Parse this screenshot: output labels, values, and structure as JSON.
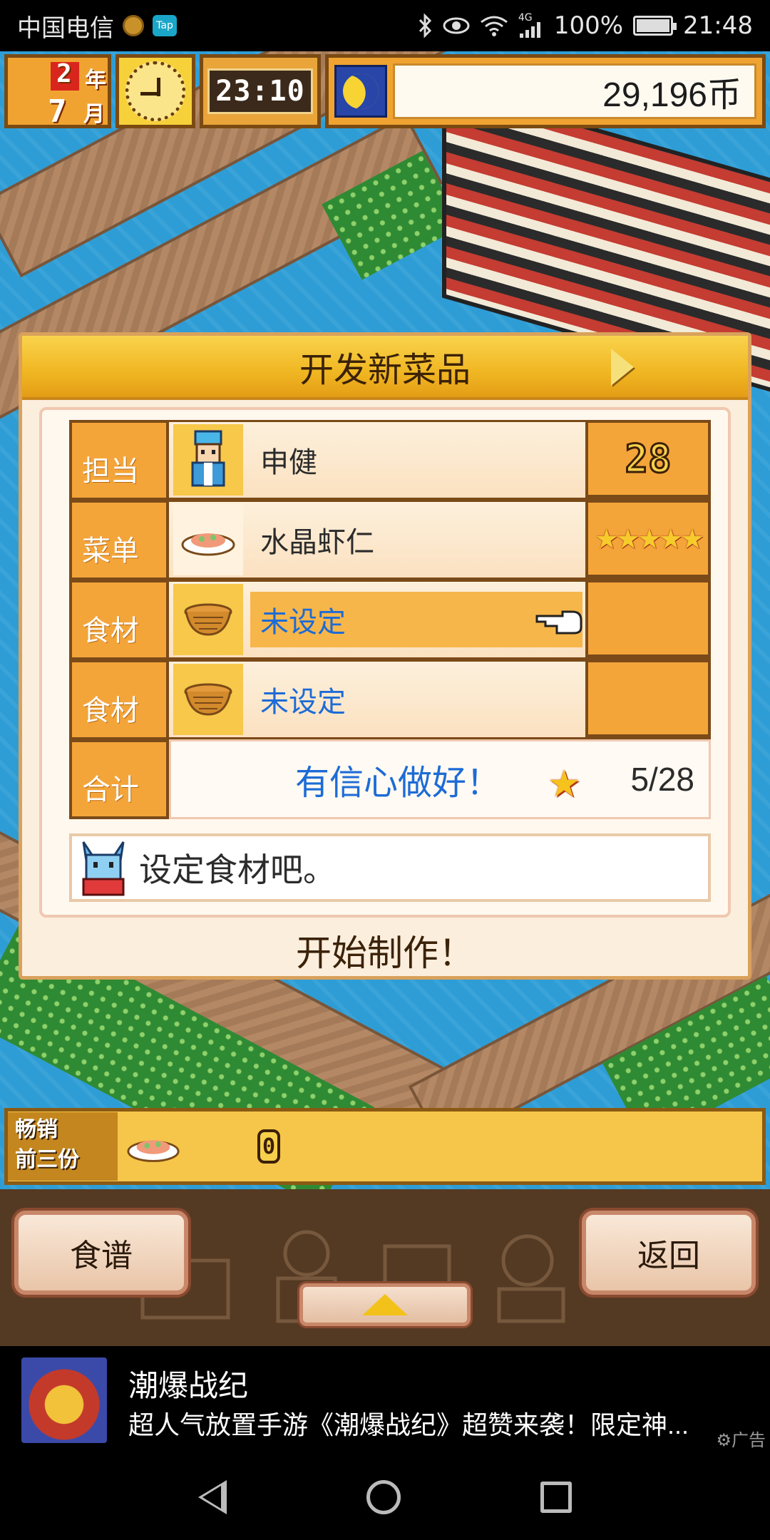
{
  "status_bar": {
    "carrier": "中国电信",
    "app_badge": "Tap",
    "network": "4G",
    "battery": "100%",
    "battery_level": 1.0,
    "time": "21:48"
  },
  "hud": {
    "year_value": "2",
    "year_unit": "年",
    "month_value": "7",
    "month_unit": "月",
    "game_time": "23:10",
    "money": "29,196币"
  },
  "dialog": {
    "title": "开发新菜品",
    "rows": [
      {
        "label": "担当",
        "value": "申健",
        "right": "28",
        "icon": "chef-icon"
      },
      {
        "label": "菜单",
        "value": "水晶虾仁",
        "right_stars": 5,
        "icon": "dish-icon"
      },
      {
        "label": "食材",
        "value": "未设定",
        "icon": "basket-icon"
      },
      {
        "label": "食材",
        "value": "未设定",
        "icon": "basket-icon"
      }
    ],
    "total_label": "合计",
    "total_message": "有信心做好！",
    "total_value": "5/28",
    "hint": "设定食材吧。",
    "start_button": "开始制作！"
  },
  "bestseller": {
    "tag_line1": "畅销",
    "tag_line2": "前三份",
    "count": "0"
  },
  "menu": {
    "recipes_button": "食谱",
    "back_button": "返回"
  },
  "ad": {
    "title": "潮爆战纪",
    "description": "超人气放置手游《潮爆战纪》超赞来袭！限定神...",
    "label": "广告"
  },
  "colors": {
    "accent_orange": "#f4a53a",
    "border_brown": "#7a4a18",
    "highlight_blue": "#1d6bd6",
    "water": "#2e9dd6"
  }
}
